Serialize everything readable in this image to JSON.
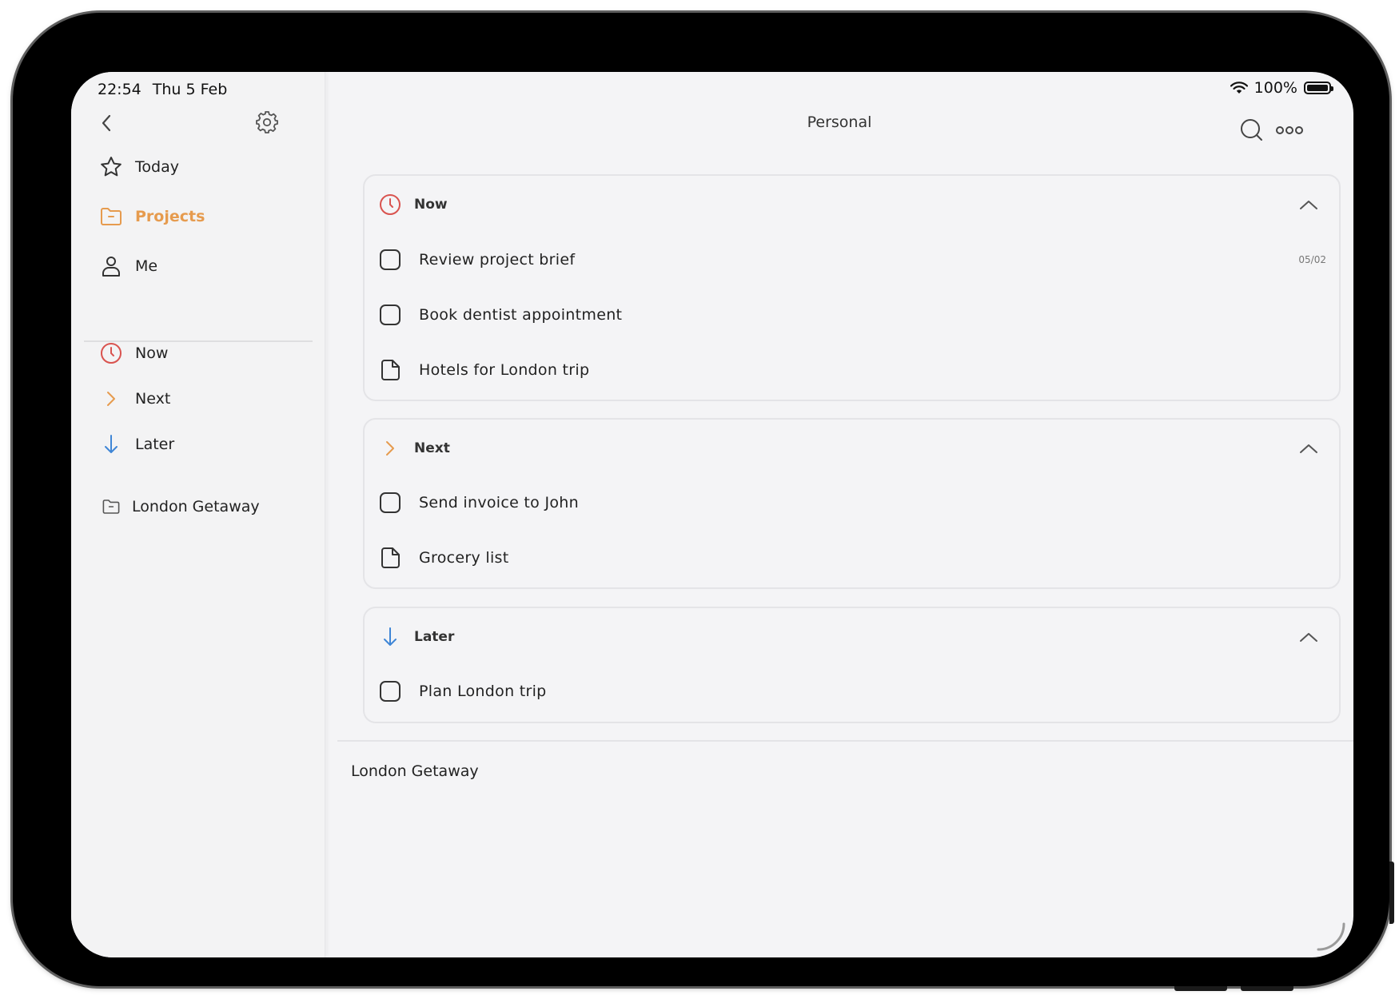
{
  "status_bar": {
    "time": "22:54",
    "date": "Thu 5 Feb",
    "battery": "100%"
  },
  "sidebar": {
    "primary": [
      {
        "label": "Today",
        "icon": "star-icon"
      },
      {
        "label": "Projects",
        "icon": "folder-icon",
        "active": true
      },
      {
        "label": "Me",
        "icon": "person-icon"
      }
    ],
    "filters": [
      {
        "label": "Now",
        "icon": "clock-icon"
      },
      {
        "label": "Next",
        "icon": "chevron-right-icon"
      },
      {
        "label": "Later",
        "icon": "arrow-down-icon"
      }
    ],
    "projects": [
      {
        "label": "London Getaway",
        "icon": "folder-icon"
      }
    ]
  },
  "main": {
    "title": "Personal",
    "sections": [
      {
        "name": "Now",
        "items": [
          {
            "label": "Review project brief",
            "type": "task",
            "date": "05/02"
          },
          {
            "label": "Book dentist appointment",
            "type": "task"
          },
          {
            "label": "Hotels for London trip",
            "type": "note"
          }
        ]
      },
      {
        "name": "Next",
        "items": [
          {
            "label": "Send invoice to John",
            "type": "task"
          },
          {
            "label": "Grocery list",
            "type": "note"
          }
        ]
      },
      {
        "name": "Later",
        "items": [
          {
            "label": "Plan London trip",
            "type": "task"
          }
        ]
      }
    ],
    "project_heading": "London Getaway",
    "fab_label": "+"
  },
  "colors": {
    "accent": "#e39a55",
    "now": "#d9534f",
    "next": "#e69b4e",
    "later": "#3f86d6",
    "background": "#f4f4f6"
  }
}
